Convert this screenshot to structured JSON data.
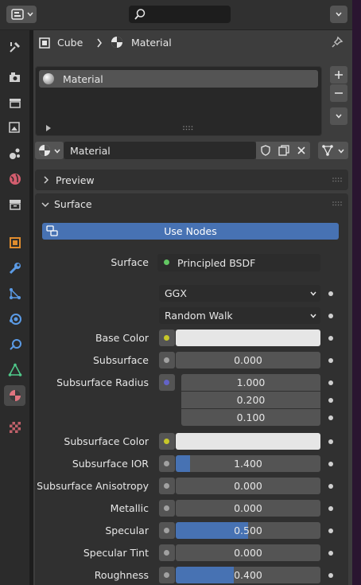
{
  "breadcrumb": {
    "object": "Cube",
    "item": "Material"
  },
  "material_slots": {
    "items": [
      "Material"
    ]
  },
  "material_selector": {
    "name": "Material"
  },
  "panels": {
    "preview": "Preview",
    "surface": "Surface"
  },
  "use_nodes": "Use Nodes",
  "surface_row": {
    "label": "Surface",
    "value": "Principled BSDF"
  },
  "distribution": "GGX",
  "subsurface_method": "Random Walk",
  "props": {
    "base_color": {
      "label": "Base Color"
    },
    "subsurface": {
      "label": "Subsurface",
      "value": "0.000"
    },
    "subsurface_radius": {
      "label": "Subsurface Radius",
      "values": [
        "1.000",
        "0.200",
        "0.100"
      ]
    },
    "subsurface_color": {
      "label": "Subsurface Color"
    },
    "subsurface_ior": {
      "label": "Subsurface IOR",
      "value": "1.400",
      "fill": 0.1
    },
    "subsurface_anisotropy": {
      "label": "Subsurface Anisotropy",
      "value": "0.000"
    },
    "metallic": {
      "label": "Metallic",
      "value": "0.000"
    },
    "specular": {
      "label": "Specular",
      "value": "0.500",
      "fill": 0.5
    },
    "specular_tint": {
      "label": "Specular Tint",
      "value": "0.000"
    },
    "roughness": {
      "label": "Roughness",
      "value": "0.400",
      "fill": 0.4
    }
  },
  "colors": {
    "accent": "#4772b3",
    "socket_color": "#c7c729",
    "socket_float": "#a1a1a1",
    "socket_vector": "#6363c7",
    "socket_shader": "#63c763"
  }
}
